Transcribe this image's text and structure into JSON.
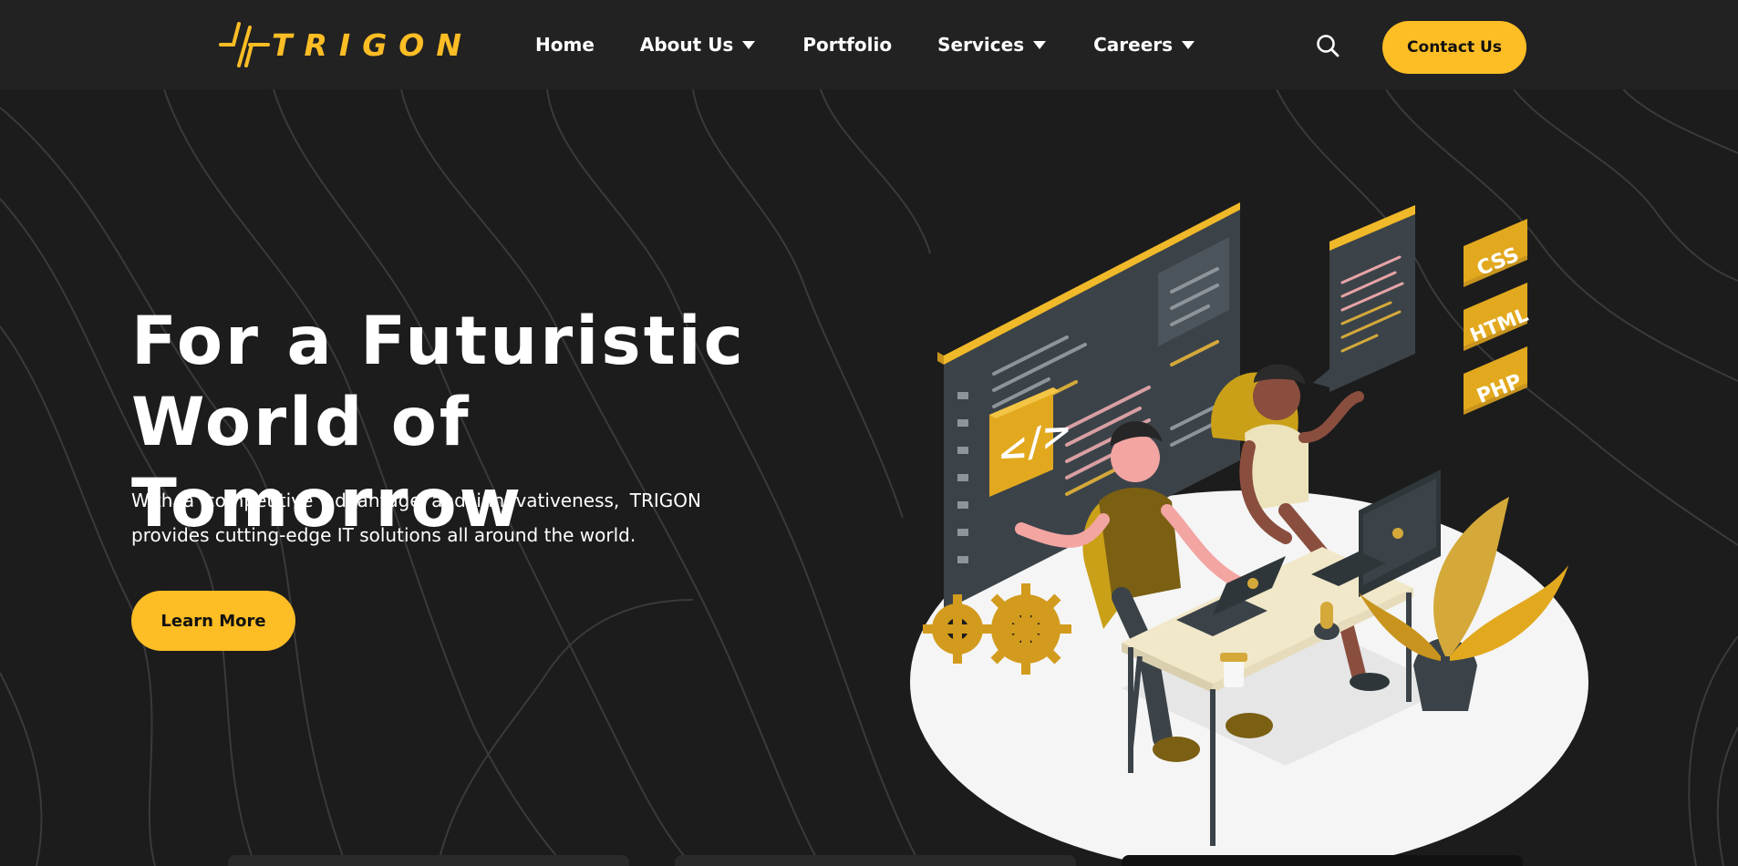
{
  "logo": {
    "text": "TRIGON",
    "icon": "trigon-logo-mark"
  },
  "nav": {
    "items": [
      {
        "label": "Home",
        "dropdown": false
      },
      {
        "label": "About Us",
        "dropdown": true
      },
      {
        "label": "Portfolio",
        "dropdown": false
      },
      {
        "label": "Services",
        "dropdown": true
      },
      {
        "label": "Careers",
        "dropdown": true
      }
    ],
    "search_icon": "search-icon",
    "contact_label": "Contact Us"
  },
  "hero": {
    "title_line1": "For a Futuristic",
    "title_line2": "World of Tomorrow",
    "description": "With a competitive advantage and innovativeness, TRIGON provides cutting-edge IT solutions all around the world.",
    "button_label": "Learn More",
    "illustration_badges": [
      "CSS",
      "HTML",
      "PHP"
    ],
    "illustration_code_symbol": "</>"
  },
  "colors": {
    "accent": "#fcbd25",
    "background": "#1c1c1c",
    "navbar": "#222222",
    "text": "#ffffff"
  }
}
